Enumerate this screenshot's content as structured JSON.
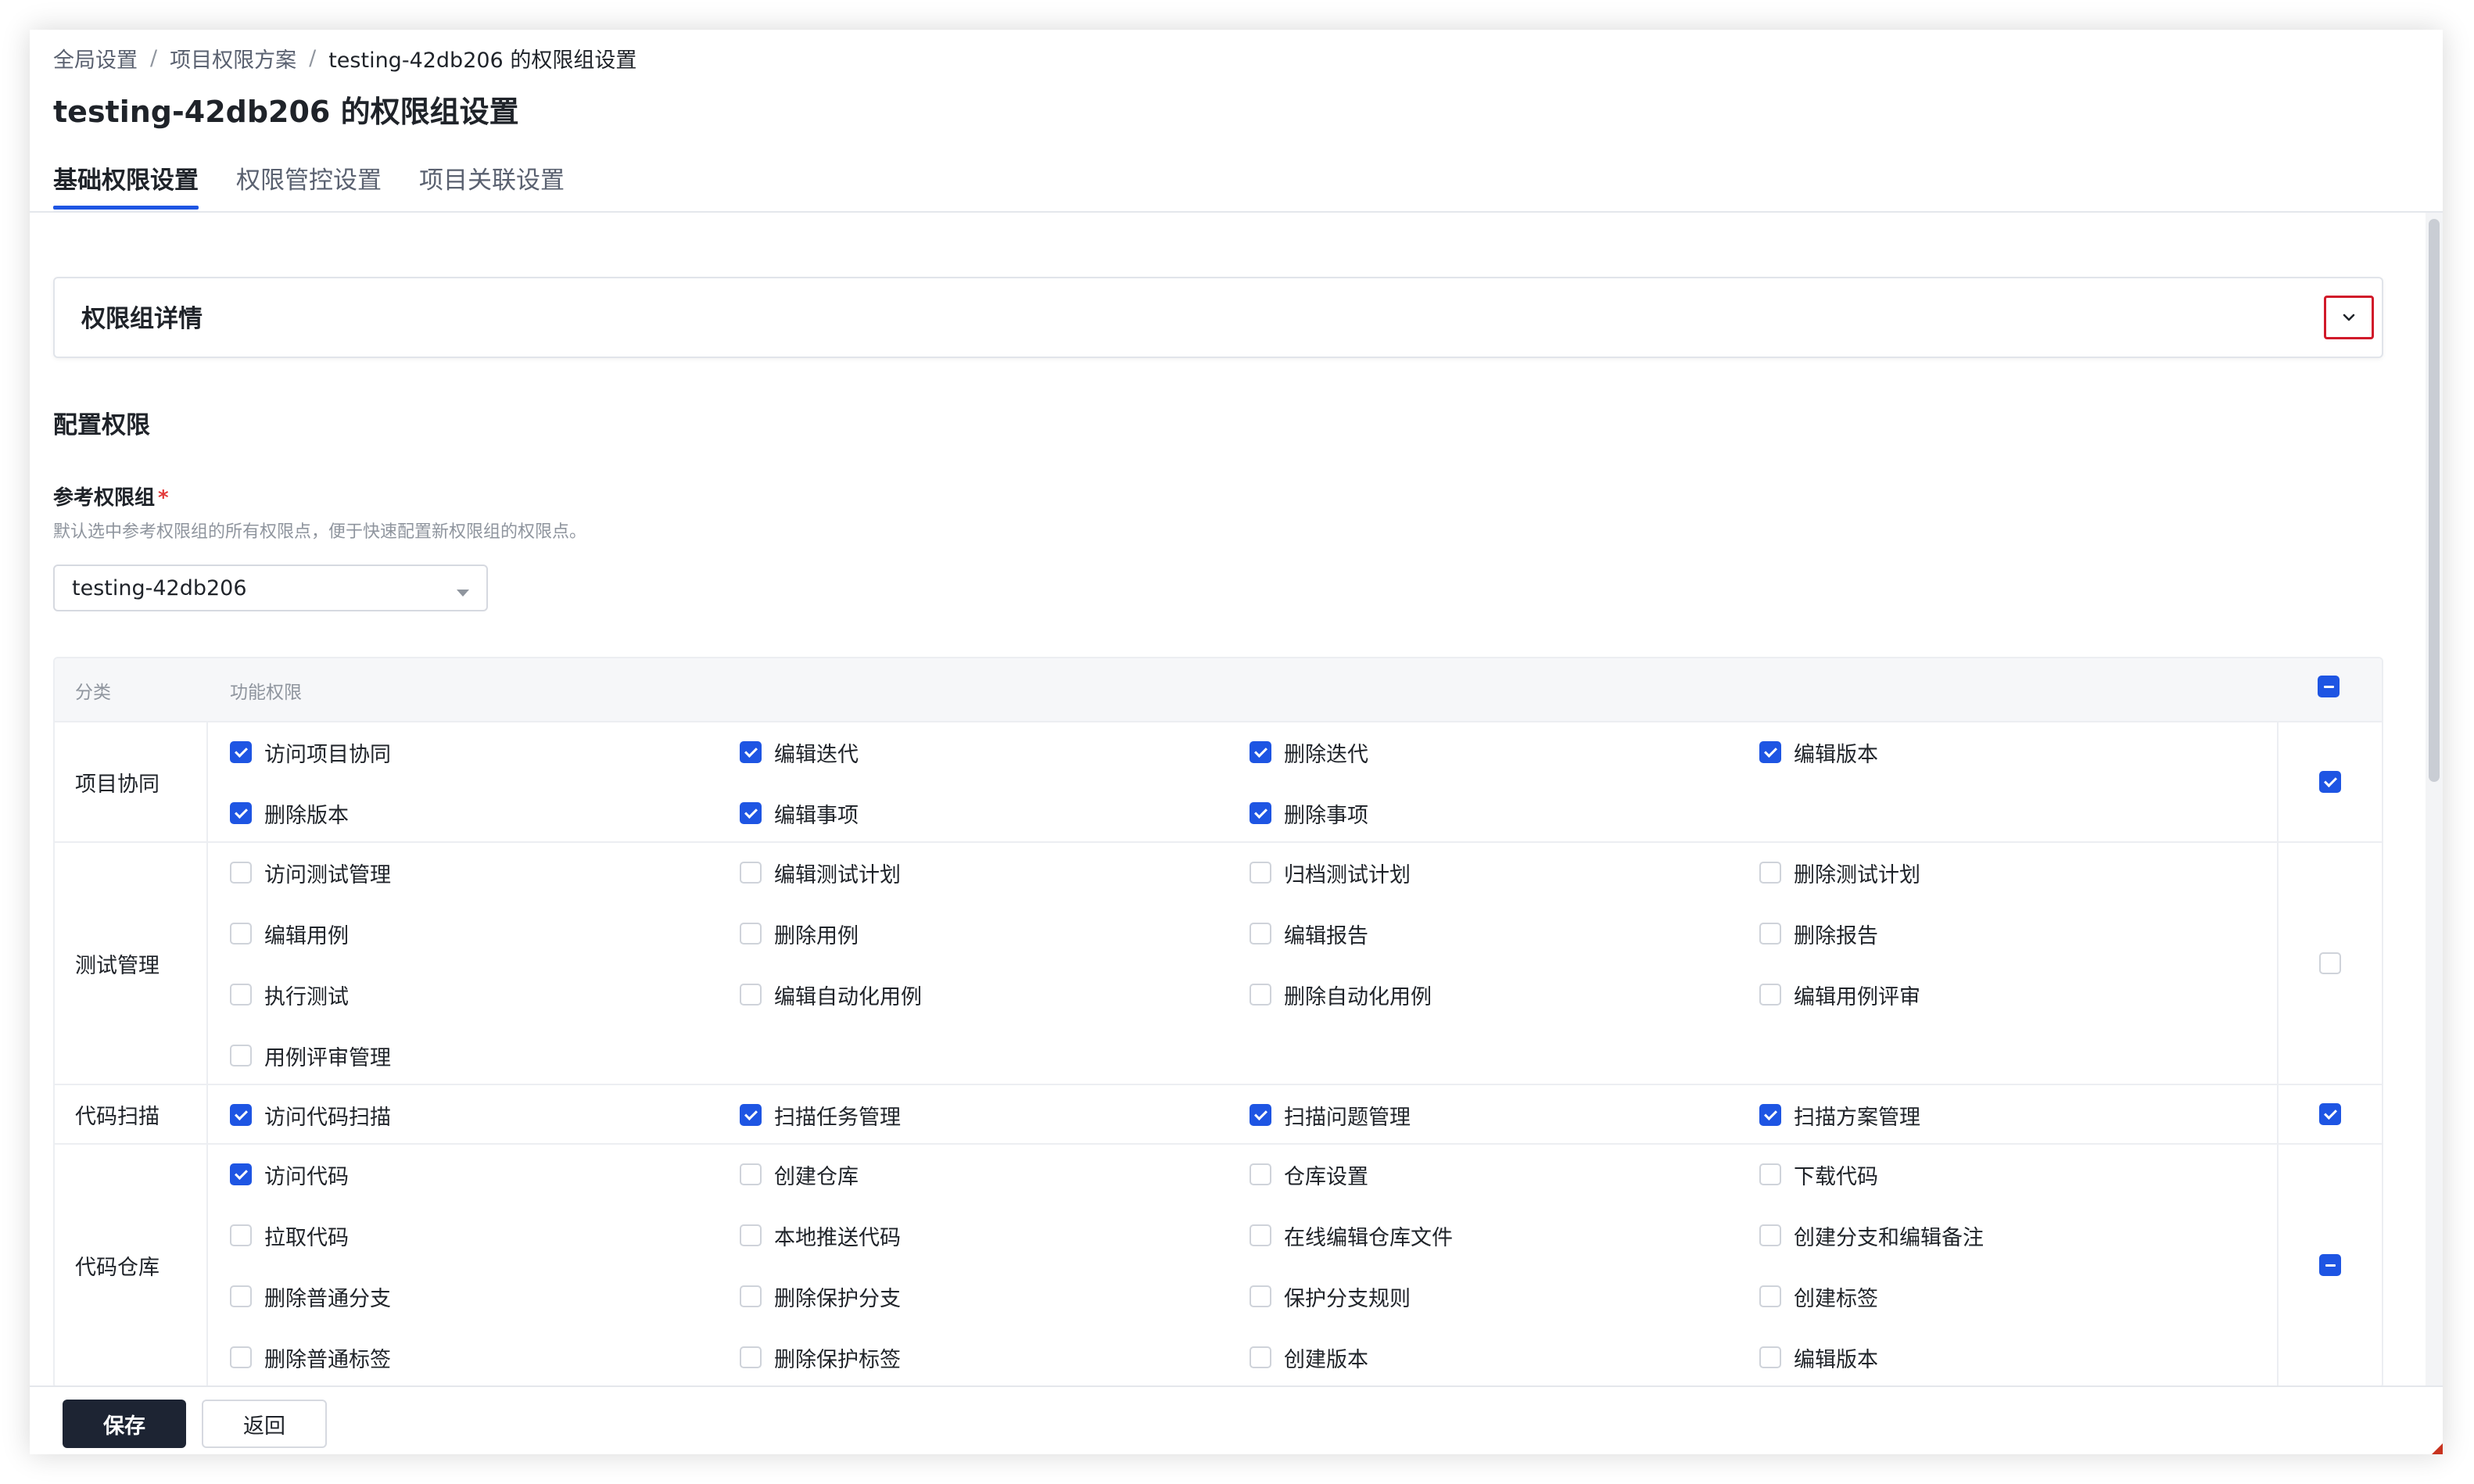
{
  "breadcrumb": {
    "item1": "全局设置",
    "item2": "项目权限方案",
    "current": "testing-42db206 的权限组设置",
    "separator": "/"
  },
  "page_title": "testing-42db206 的权限组设置",
  "tabs": [
    "基础权限设置",
    "权限管控设置",
    "项目关联设置"
  ],
  "active_tab": "基础权限设置",
  "detail_card": {
    "title": "权限组详情",
    "toggle_icon": "chevron-down-icon"
  },
  "config": {
    "section_title": "配置权限",
    "ref_label": "参考权限组",
    "required_mark": "*",
    "ref_hint": "默认选中参考权限组的所有权限点，便于快速配置新权限组的权限点。",
    "ref_value": "testing-42db206"
  },
  "table": {
    "col_category": "分类",
    "col_permissions": "功能权限",
    "header_check_state": "indeterminate",
    "rows": [
      {
        "category": "项目协同",
        "state": "checked",
        "perms": [
          {
            "label": "访问项目协同",
            "checked": true
          },
          {
            "label": "编辑迭代",
            "checked": true
          },
          {
            "label": "删除迭代",
            "checked": true
          },
          {
            "label": "编辑版本",
            "checked": true
          },
          {
            "label": "删除版本",
            "checked": true
          },
          {
            "label": "编辑事项",
            "checked": true
          },
          {
            "label": "删除事项",
            "checked": true
          }
        ]
      },
      {
        "category": "测试管理",
        "state": "unchecked",
        "perms": [
          {
            "label": "访问测试管理",
            "checked": false
          },
          {
            "label": "编辑测试计划",
            "checked": false
          },
          {
            "label": "归档测试计划",
            "checked": false
          },
          {
            "label": "删除测试计划",
            "checked": false
          },
          {
            "label": "编辑用例",
            "checked": false
          },
          {
            "label": "删除用例",
            "checked": false
          },
          {
            "label": "编辑报告",
            "checked": false
          },
          {
            "label": "删除报告",
            "checked": false
          },
          {
            "label": "执行测试",
            "checked": false
          },
          {
            "label": "编辑自动化用例",
            "checked": false
          },
          {
            "label": "删除自动化用例",
            "checked": false
          },
          {
            "label": "编辑用例评审",
            "checked": false
          },
          {
            "label": "用例评审管理",
            "checked": false
          }
        ]
      },
      {
        "category": "代码扫描",
        "state": "checked",
        "perms": [
          {
            "label": "访问代码扫描",
            "checked": true
          },
          {
            "label": "扫描任务管理",
            "checked": true
          },
          {
            "label": "扫描问题管理",
            "checked": true
          },
          {
            "label": "扫描方案管理",
            "checked": true
          }
        ]
      },
      {
        "category": "代码仓库",
        "state": "indeterminate",
        "perms": [
          {
            "label": "访问代码",
            "checked": true
          },
          {
            "label": "创建仓库",
            "checked": false
          },
          {
            "label": "仓库设置",
            "checked": false
          },
          {
            "label": "下载代码",
            "checked": false
          },
          {
            "label": "拉取代码",
            "checked": false
          },
          {
            "label": "本地推送代码",
            "checked": false
          },
          {
            "label": "在线编辑仓库文件",
            "checked": false
          },
          {
            "label": "创建分支和编辑备注",
            "checked": false
          },
          {
            "label": "删除普通分支",
            "checked": false
          },
          {
            "label": "删除保护分支",
            "checked": false
          },
          {
            "label": "保护分支规则",
            "checked": false
          },
          {
            "label": "创建标签",
            "checked": false
          },
          {
            "label": "删除普通标签",
            "checked": false
          },
          {
            "label": "删除保护标签",
            "checked": false
          },
          {
            "label": "创建版本",
            "checked": false
          },
          {
            "label": "编辑版本",
            "checked": false
          }
        ]
      }
    ]
  },
  "footer": {
    "save": "保存",
    "back": "返回"
  },
  "colors": {
    "primary": "#1e55e3",
    "dark_button": "#1d2433",
    "highlight_border": "#d11a2a"
  }
}
